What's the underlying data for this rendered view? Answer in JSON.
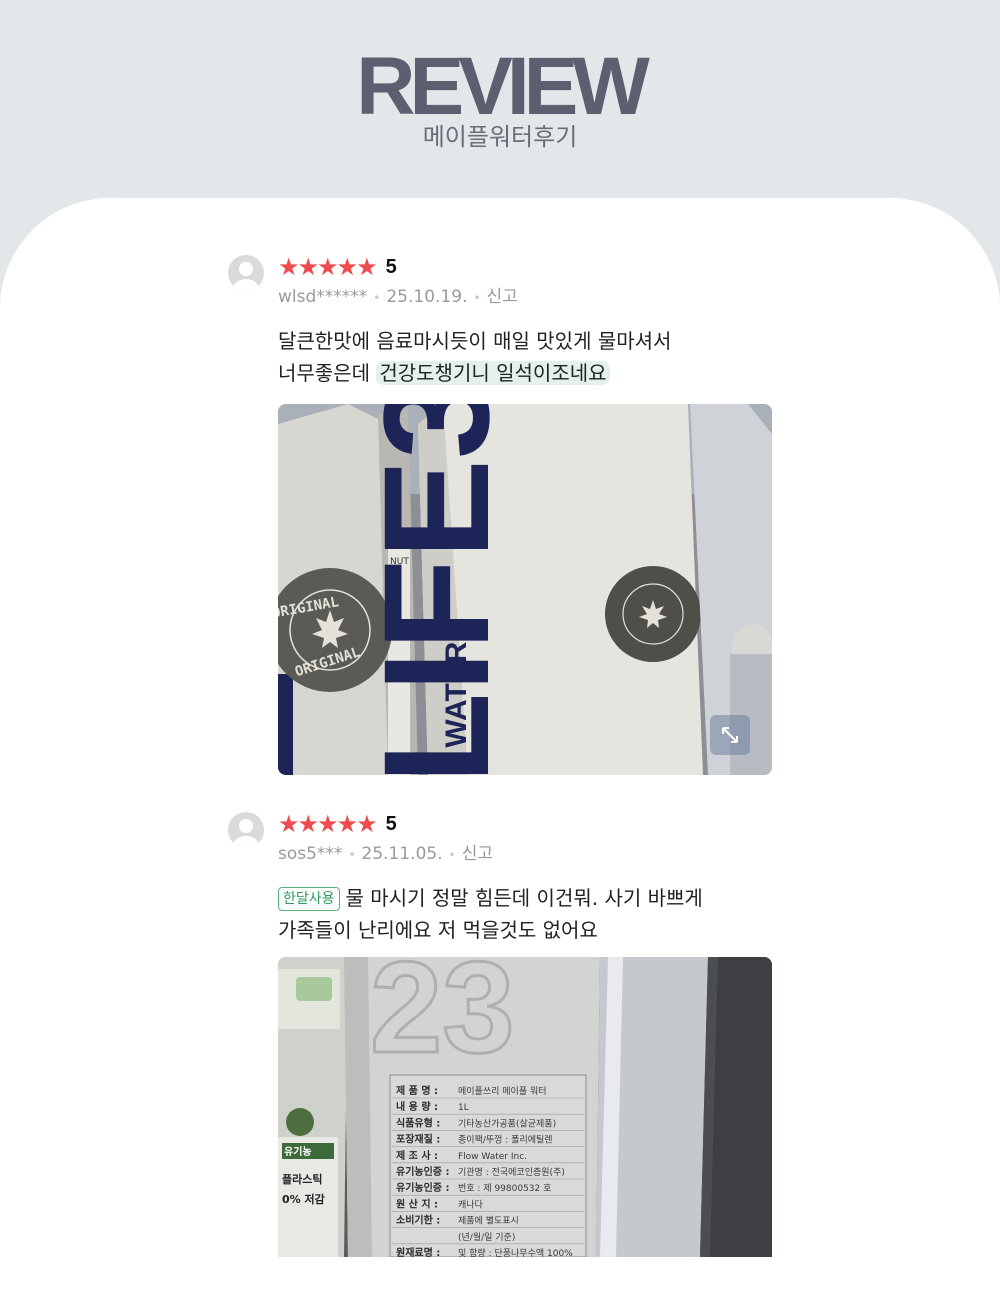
{
  "header": {
    "title": "REVIEW",
    "subtitle": "메이플워터후기"
  },
  "colors": {
    "page_bg": "#e4e7ea",
    "card_bg": "#ffffff",
    "title": "#5c5f70",
    "star": "#ef4b4f",
    "highlight": "#e3f1ea",
    "tag": "#2e9a5c"
  },
  "reviews": [
    {
      "stars": "★★★★★",
      "rating": "5",
      "user": "wlsd******",
      "date": "25.10.19.",
      "report": "신고",
      "line1": "달큰한맛에 음료마시듯이 매일 맛있게 물마셔서",
      "line2_plain": "너무좋은데 ",
      "line2_highlight": "건강도챙기니 일석이조네요",
      "photo": {
        "label_big": "LIFE3",
        "label_side": "E WATER",
        "seal": "ORIGINAL",
        "panel_text": "NUT"
      },
      "expand_icon": "expand-icon"
    },
    {
      "stars": "★★★★★",
      "rating": "5",
      "user": "sos5***",
      "date": "25.11.05.",
      "report": "신고",
      "tag": "한달사용",
      "line1": "물 마시기 정말 힘든데 이건뭐. 사기 바쁘게",
      "line2": "가족들이 난리에요 저 먹을것도 없어요",
      "photo": {
        "big_number": "23",
        "side_texts": [
          "유기농",
          "플라스틱",
          "0% 저감"
        ],
        "label_rows": [
          [
            "제 품 명 :",
            "메이플쓰리 메이플 워터"
          ],
          [
            "내 용 량 :",
            "1L"
          ],
          [
            "식품유형 :",
            "기타농산가공품(살균제품)"
          ],
          [
            "포장재질 :",
            "종이팩/뚜껑 : 폴리에틸렌"
          ],
          [
            "제 조 사 :",
            "Flow Water Inc."
          ],
          [
            "유기농인증 :",
            "기관명 : 전국에코인증원(주)"
          ],
          [
            "유기농인증 :",
            "번호 : 제 99800532 호"
          ],
          [
            "원 산 지 :",
            "캐나다"
          ],
          [
            "소비기한 :",
            "제품에 별도표시"
          ],
          [
            "",
            "(년/월/일 기준)"
          ],
          [
            "원재료명 :",
            "및 함량 : 단풍나무수액 100%"
          ]
        ]
      }
    }
  ]
}
